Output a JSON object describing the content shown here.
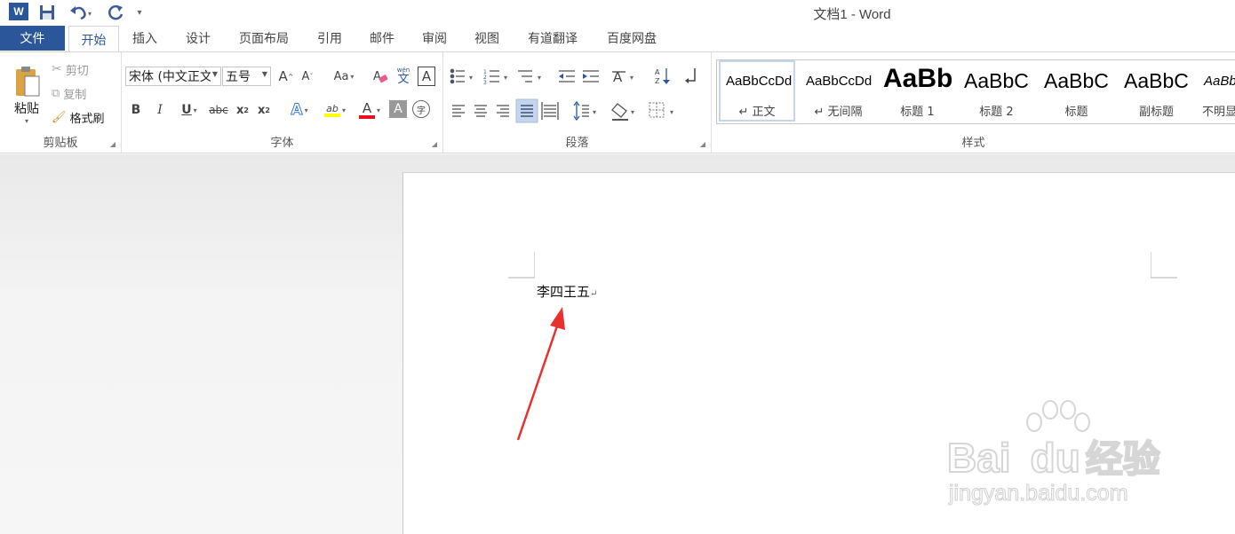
{
  "app": {
    "title": "文档1 - Word",
    "logo_letter": "W"
  },
  "qat": {
    "save_icon": "save-icon",
    "undo_icon": "undo-icon",
    "redo_icon": "redo-icon",
    "customize_icon": "customize-qat-icon"
  },
  "tabs": {
    "file": "文件",
    "items": [
      "开始",
      "插入",
      "设计",
      "页面布局",
      "引用",
      "邮件",
      "审阅",
      "视图",
      "有道翻译",
      "百度网盘"
    ]
  },
  "clipboard": {
    "label": "剪贴板",
    "paste": "粘贴",
    "cut": "剪切",
    "copy": "复制",
    "format_painter": "格式刷"
  },
  "font": {
    "label": "字体",
    "font_name": "宋体 (中文正文)",
    "font_size": "五号",
    "change_case": "Aa",
    "pinyin_top": "wén",
    "pinyin_bottom": "文",
    "border_char": "A",
    "bold": "B",
    "italic": "I",
    "underline": "U",
    "strikethrough": "abc",
    "subscript_base": "x",
    "subscript_sub": "2",
    "superscript_base": "x",
    "superscript_sup": "2",
    "text_effects": "A",
    "highlight": "ab",
    "font_color": "A",
    "char_shading": "A",
    "enclose": "字",
    "grow": "A",
    "shrink": "A"
  },
  "paragraph": {
    "label": "段落"
  },
  "styles": {
    "label": "样式",
    "items": [
      {
        "preview": "AaBbCcDd",
        "name": "↵ 正文"
      },
      {
        "preview": "AaBbCcDd",
        "name": "↵ 无间隔"
      },
      {
        "preview": "AaBb",
        "name": "标题 1"
      },
      {
        "preview": "AaBbC",
        "name": "标题 2"
      },
      {
        "preview": "AaBbC",
        "name": "标题"
      },
      {
        "preview": "AaBbC",
        "name": "副标题"
      },
      {
        "preview": "AaBb",
        "name": "不明显"
      }
    ]
  },
  "document": {
    "text": "李四王五",
    "paragraph_mark": "↵"
  },
  "watermark": {
    "brand": "Bai",
    "brand2": "du",
    "cn": "经验",
    "url": "jingyan.baidu.com"
  },
  "colors": {
    "accent": "#2b579a",
    "arrow": "#e8312f",
    "highlight": "#ffff00",
    "font_color": "#e81123"
  }
}
